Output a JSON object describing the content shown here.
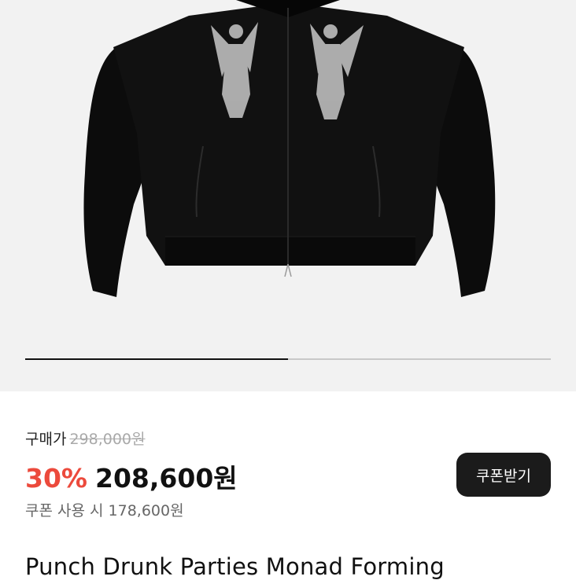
{
  "price": {
    "purchase_label": "구매가",
    "original_price": "298,000원",
    "discount_rate": "30%",
    "sale_price": "208,600원",
    "coupon_note": "쿠폰 사용 시 178,600원",
    "coupon_button_label": "쿠폰받기"
  },
  "carousel": {
    "progress_fraction": 0.5
  },
  "product": {
    "title": "Punch Drunk Parties Monad Forming"
  },
  "colors": {
    "discount": "#ec4a3c",
    "button_bg": "#1b1b1b"
  }
}
